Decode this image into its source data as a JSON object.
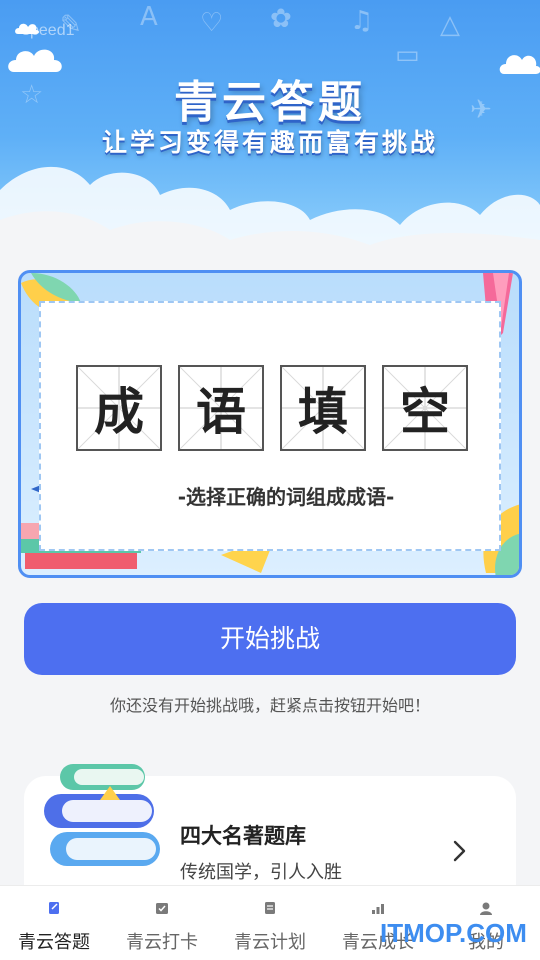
{
  "status_bar": {
    "text": "speed1"
  },
  "header": {
    "title": "青云答题",
    "subtitle": "让学习变得有趣而富有挑战"
  },
  "banner": {
    "idiom_chars": [
      "成",
      "语",
      "填",
      "空"
    ],
    "caption": "-选择正确的词组成成语-"
  },
  "start_button": {
    "label": "开始挑战"
  },
  "hint": "你还没有开始挑战哦，赶紧点击按钮开始吧！",
  "card": {
    "title": "四大名著题库",
    "subtitle": "传统国学，引人入胜"
  },
  "bottom_nav": {
    "items": [
      {
        "label": "青云答题",
        "icon": "quiz-icon",
        "active": true
      },
      {
        "label": "青云打卡",
        "icon": "checkin-icon",
        "active": false
      },
      {
        "label": "青云计划",
        "icon": "plan-icon",
        "active": false
      },
      {
        "label": "青云成长",
        "icon": "growth-icon",
        "active": false
      },
      {
        "label": "我的",
        "icon": "profile-icon",
        "active": false
      }
    ]
  },
  "watermark": "ITMOP.COM",
  "colors": {
    "accent": "#4d6ff0",
    "header_blue": "#4a9cf2",
    "watermark": "#3d8df0"
  }
}
